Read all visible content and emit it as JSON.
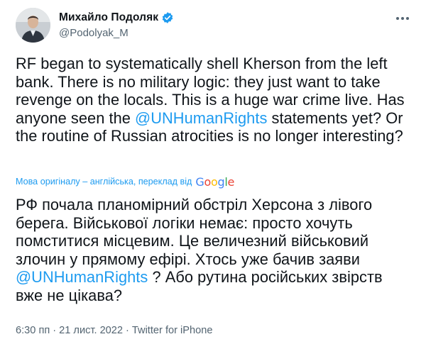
{
  "author": {
    "display_name": "Михайло Подоляк",
    "handle": "@Podolyak_M",
    "avatar_icon": "person-avatar-icon",
    "verified_icon": "verified-badge-icon"
  },
  "tweet": {
    "original": {
      "before_mention": "RF began to systematically shell Kherson from the left bank. There is no military logic: they just want to take revenge on the locals. This is a huge war crime live. Has anyone seen the ",
      "mention": "@UNHumanRights",
      "after_mention": " statements yet? Or the routine of Russian atrocities is no longer interesting?"
    },
    "translation_notice": "Мова оригіналу – англійська, переклад від",
    "google_logo": {
      "G": "G",
      "o1": "o",
      "o2": "o",
      "g": "g",
      "l": "l",
      "e": "e"
    },
    "translated": {
      "before_mention": "РФ почала планомірний обстріл Херсона з лівого берега. Військової логіки немає: просто хочуть помститися місцевим. Це величезний військовий злочин у прямому ефірі. Хтось уже бачив заяви ",
      "mention": "@UNHumanRights",
      "after_mention": " ? Або рутина російських звірств вже не цікава?"
    },
    "time": "6:30 пп",
    "separator": "·",
    "date": "21 лист. 2022",
    "source": "Twitter for iPhone"
  },
  "colors": {
    "link": "#1d9bf0",
    "text": "#0f1419",
    "secondary": "#536471"
  }
}
